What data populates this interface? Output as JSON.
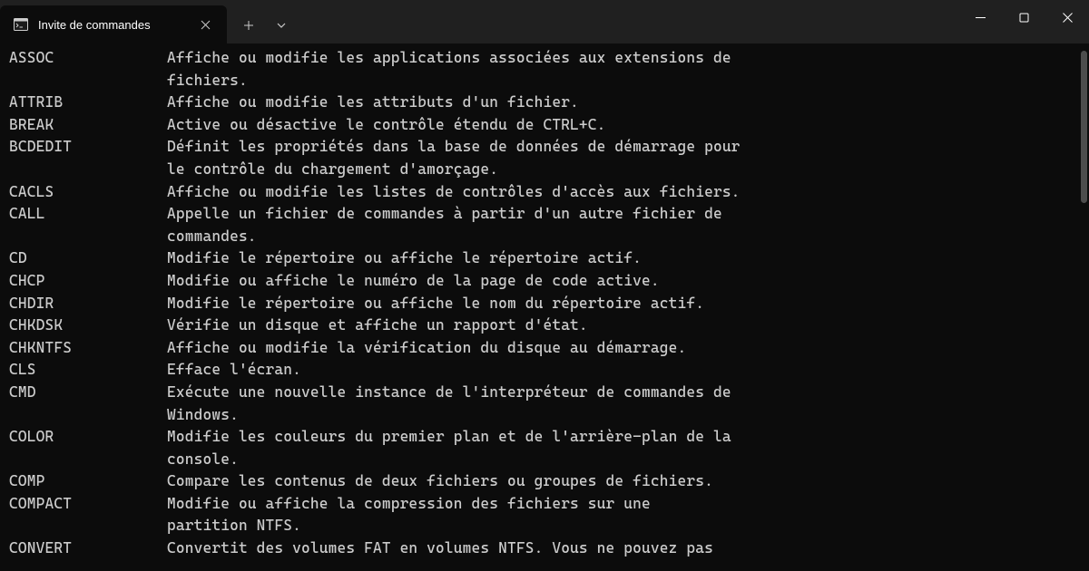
{
  "window": {
    "tab_title": "Invite de commandes",
    "new_tab_label": "+",
    "dropdown_label": "⌄"
  },
  "commands": [
    {
      "name": "ASSOC",
      "desc": [
        "Affiche ou modifie les applications associées aux extensions de",
        "fichiers."
      ]
    },
    {
      "name": "ATTRIB",
      "desc": [
        "Affiche ou modifie les attributs d'un fichier."
      ]
    },
    {
      "name": "BREAK",
      "desc": [
        "Active ou désactive le contrôle étendu de CTRL+C."
      ]
    },
    {
      "name": "BCDEDIT",
      "desc": [
        "Définit les propriétés dans la base de données de démarrage pour",
        "le contrôle du chargement d'amorçage."
      ]
    },
    {
      "name": "CACLS",
      "desc": [
        "Affiche ou modifie les listes de contrôles d'accès aux fichiers."
      ]
    },
    {
      "name": "CALL",
      "desc": [
        "Appelle un fichier de commandes à partir d'un autre fichier de",
        "commandes."
      ]
    },
    {
      "name": "CD",
      "desc": [
        "Modifie le répertoire ou affiche le répertoire actif."
      ]
    },
    {
      "name": "CHCP",
      "desc": [
        "Modifie ou affiche le numéro de la page de code active."
      ]
    },
    {
      "name": "CHDIR",
      "desc": [
        "Modifie le répertoire ou affiche le nom du répertoire actif."
      ]
    },
    {
      "name": "CHKDSK",
      "desc": [
        "Vérifie un disque et affiche un rapport d'état."
      ]
    },
    {
      "name": "CHKNTFS",
      "desc": [
        "Affiche ou modifie la vérification du disque au démarrage."
      ]
    },
    {
      "name": "CLS",
      "desc": [
        "Efface l'écran."
      ]
    },
    {
      "name": "CMD",
      "desc": [
        "Exécute une nouvelle instance de l'interpréteur de commandes de",
        "Windows."
      ]
    },
    {
      "name": "COLOR",
      "desc": [
        "Modifie les couleurs du premier plan et de l'arrière-plan de la",
        "console."
      ]
    },
    {
      "name": "COMP",
      "desc": [
        "Compare les contenus de deux fichiers ou groupes de fichiers."
      ]
    },
    {
      "name": "COMPACT",
      "desc": [
        "Modifie ou affiche la compression des fichiers sur une",
        "partition NTFS."
      ]
    },
    {
      "name": "CONVERT",
      "desc": [
        "Convertit des volumes FAT en volumes NTFS. Vous ne pouvez pas"
      ]
    }
  ]
}
